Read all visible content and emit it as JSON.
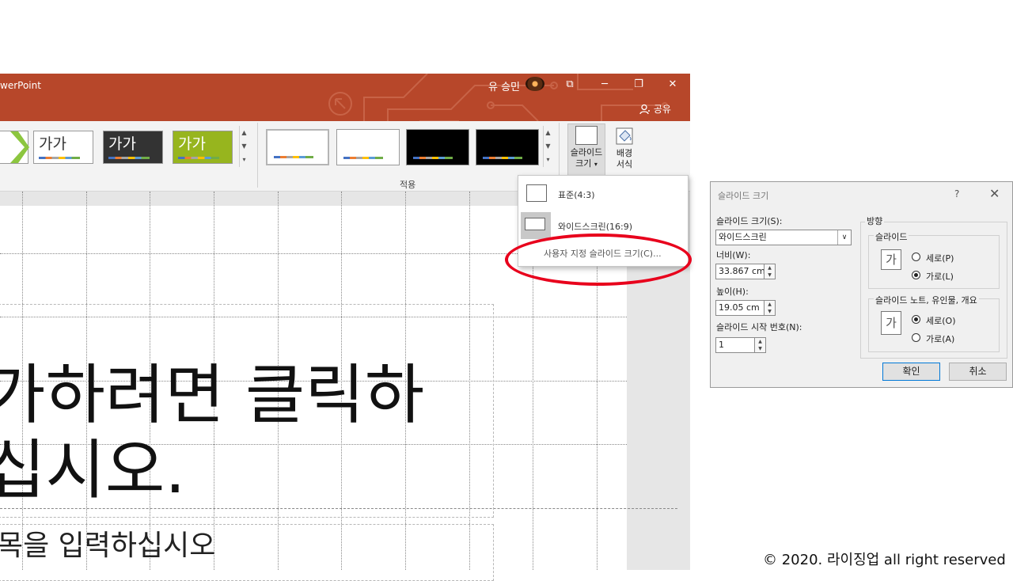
{
  "window": {
    "app_title": "werPoint",
    "user_name": "유 승민",
    "share_label": "공유",
    "controls": {
      "ribbon_display": "⧉",
      "minimize": "─",
      "restore": "❐",
      "close": "✕"
    }
  },
  "ribbon": {
    "themes": [
      {
        "label": "가가",
        "bg": "#ffffff",
        "fg": "#333333"
      },
      {
        "label": "가가",
        "bg": "#333333",
        "fg": "#ffffff"
      },
      {
        "label": "가가",
        "bg": "#97b51e",
        "fg": "#ffffff"
      }
    ],
    "variants": [
      {
        "bg": "#ffffff"
      },
      {
        "bg": "#ffffff"
      },
      {
        "bg": "#000000"
      },
      {
        "bg": "#000000"
      }
    ],
    "variants_group_label": "적용",
    "slide_size_button": {
      "line1": "슬라이드",
      "line2": "크기"
    },
    "format_bg_button": {
      "line1": "배경",
      "line2": "서식"
    }
  },
  "slide": {
    "title_line1": "가하려면 클릭하",
    "title_line2": "십시오.",
    "subtitle": "목을 입력하십시오"
  },
  "slide_size_menu": {
    "items": [
      {
        "label": "표준(4:3)"
      },
      {
        "label": "와이드스크린(16:9)"
      }
    ],
    "custom_label": "사용자 지정 슬라이드 크기(C)..."
  },
  "dialog": {
    "title": "슬라이드 크기",
    "help": "?",
    "close": "✕",
    "size_label": "슬라이드 크기(S):",
    "size_value": "와이드스크린",
    "width_label": "너비(W):",
    "width_value": "33.867 cm",
    "height_label": "높이(H):",
    "height_value": "19.05 cm",
    "start_label": "슬라이드 시작 번호(N):",
    "start_value": "1",
    "orientation_label": "방향",
    "slides_group": "슬라이드",
    "slides_portrait": "세로(P)",
    "slides_landscape": "가로(L)",
    "notes_group": "슬라이드 노트, 유인물, 개요",
    "notes_portrait": "세로(O)",
    "notes_landscape": "가로(A)",
    "orient_icon_text": "가",
    "ok": "확인",
    "cancel": "취소"
  },
  "footer": {
    "copyright": "© 2020. 라이징업 all right reserved"
  },
  "colors": {
    "title_bar": "#b7472a",
    "highlight_ellipse": "#e8001c"
  }
}
